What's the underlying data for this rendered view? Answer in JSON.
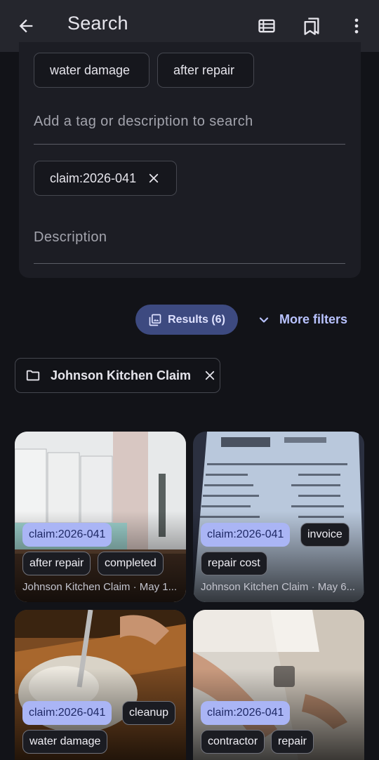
{
  "appbar": {
    "title": "Search",
    "icons": [
      "arrow-back-icon",
      "list-view-icon",
      "bookmarks-icon",
      "more-vert-icon"
    ]
  },
  "search": {
    "tag_chips": [
      {
        "label": "water damage"
      },
      {
        "label": "after repair"
      }
    ],
    "tag_placeholder": "Add a tag or description to search",
    "active_chip": {
      "label": "claim:2026-041"
    },
    "description_placeholder": "Description"
  },
  "results": {
    "label": "Results (6)",
    "more_filters": "More filters"
  },
  "folder_filter": {
    "label": "Johnson Kitchen Claim"
  },
  "photos": [
    {
      "tags_row1": [
        "claim:2026-041"
      ],
      "tags_row2": [
        "after repair",
        "completed"
      ],
      "caption": "Johnson Kitchen Claim · May 1..."
    },
    {
      "tags_row1": [
        "claim:2026-041",
        "invoice"
      ],
      "tags_row2": [
        "repair cost"
      ],
      "caption": "Johnson Kitchen Claim · May 6..."
    },
    {
      "tags_row1": [
        "claim:2026-041",
        "cleanup"
      ],
      "tags_row2": [
        "water damage"
      ],
      "caption": ""
    },
    {
      "tags_row1": [
        "claim:2026-041"
      ],
      "tags_row2": [
        "contractor",
        "repair"
      ],
      "caption": ""
    }
  ],
  "colors": {
    "background": "#121318",
    "appbar": "#25262d",
    "accent": "#3d4a80",
    "tag_primary": "#aab5f5"
  }
}
